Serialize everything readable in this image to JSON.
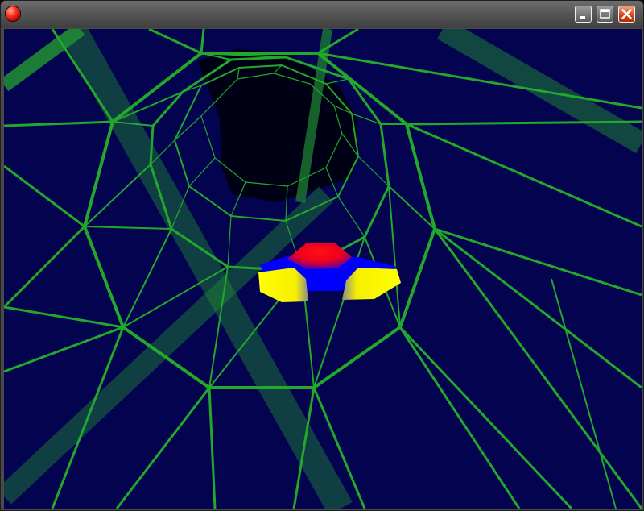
{
  "window": {
    "title": ""
  },
  "controls": {
    "minimize": "minimize",
    "maximize": "maximize",
    "close": "close"
  },
  "scene": {
    "background": "#03034f",
    "tunnel_color": "#22a82a",
    "light_beam_color": "#1f8a34",
    "void_color": "#000010",
    "ship_colors": {
      "wing": "#ffff00",
      "cockpit": "#ff0000",
      "body": "#0000ff"
    }
  }
}
